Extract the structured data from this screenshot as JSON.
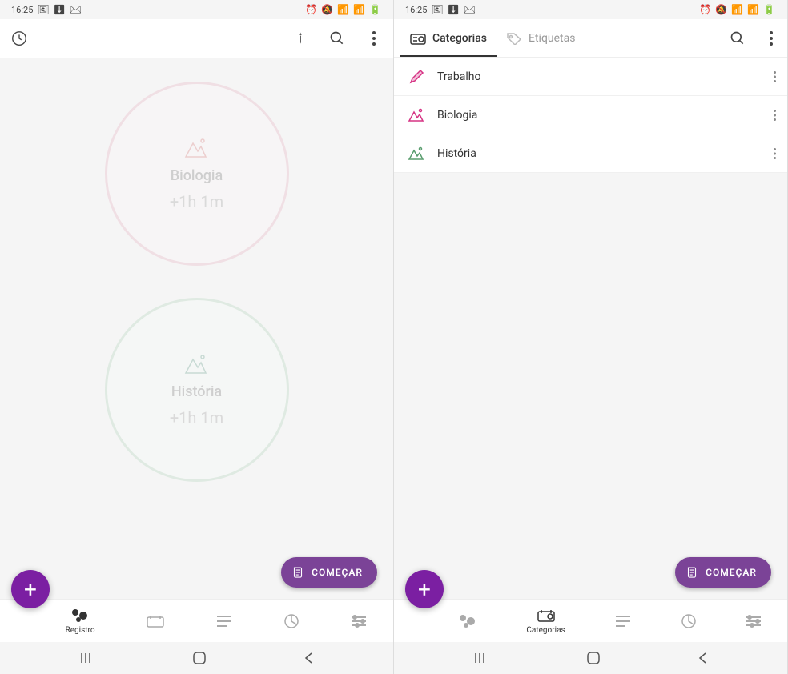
{
  "status": {
    "time": "16:25",
    "left_icons": "🖼 ⬇ ✉",
    "right_icons": "⏰ 🔕 📶 📶 🔋"
  },
  "left": {
    "circles": [
      {
        "title": "Biologia",
        "time": "+1h 1m",
        "color": "pink"
      },
      {
        "title": "História",
        "time": "+1h 1m",
        "color": "green"
      }
    ],
    "start_label": "COMEÇAR",
    "bottom_tabs": [
      "Registro",
      "",
      "",
      "",
      ""
    ],
    "active_tab": "Registro"
  },
  "right": {
    "tabs": [
      {
        "label": "Categorias",
        "active": true
      },
      {
        "label": "Etiquetas",
        "active": false
      }
    ],
    "categories": [
      {
        "name": "Trabalho",
        "icon": "pen",
        "color": "#d63384"
      },
      {
        "name": "Biologia",
        "icon": "mountain",
        "color": "#d63384"
      },
      {
        "name": "História",
        "icon": "mountain",
        "color": "#5a9e6f"
      }
    ],
    "start_label": "COMEÇAR",
    "bottom_tabs": [
      "",
      "Categorias",
      "",
      "",
      ""
    ],
    "active_tab": "Categorias"
  }
}
